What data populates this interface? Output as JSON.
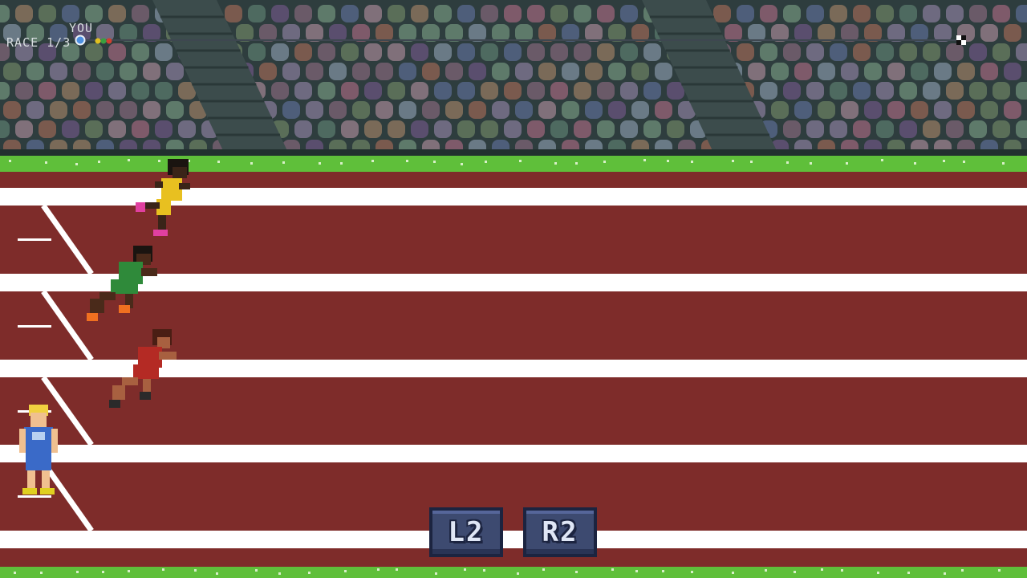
{
  "hud": {
    "race_label": "RACE 1/3",
    "player_label": "YOU",
    "progress": {
      "player_color": "#4c8fe0",
      "opponent_colors": [
        "#e0c020",
        "#3aa040",
        "#d04030"
      ]
    }
  },
  "controls": {
    "left_button": "L2",
    "right_button": "R2"
  },
  "colors": {
    "track": "#7e2c2a",
    "lane_line": "#ffffff",
    "grass": "#5fbf3a",
    "stands": "#2b3a3a"
  },
  "runners": [
    {
      "name": "runner-yellow",
      "kit": "#e8c020",
      "skin": "#3a2418",
      "shoe": "#e040a0"
    },
    {
      "name": "runner-green",
      "kit": "#2f8a3a",
      "skin": "#4a2a1a",
      "shoe": "#f07020"
    },
    {
      "name": "runner-red",
      "kit": "#b42a24",
      "skin": "#a86040",
      "shoe": "#2a2a2a"
    },
    {
      "name": "runner-player-blue",
      "kit": "#3a6ac8",
      "skin": "#f0c090",
      "hair": "#f0d040",
      "shoe": "#e0d020"
    }
  ]
}
